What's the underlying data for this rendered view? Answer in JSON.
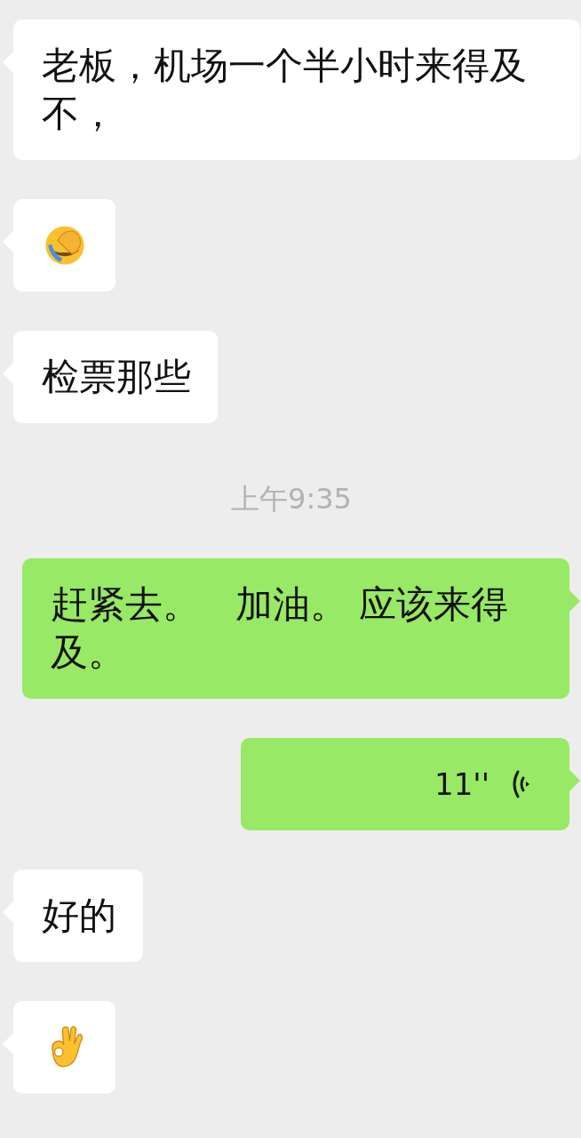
{
  "messages": [
    {
      "kind": "text",
      "outgoing": false,
      "text": "老板，机场一个半小时来得及不，"
    },
    {
      "kind": "facepalm",
      "outgoing": false
    },
    {
      "kind": "text",
      "outgoing": false,
      "text": "检票那些"
    },
    {
      "kind": "time",
      "text": "上午9:35"
    },
    {
      "kind": "text",
      "outgoing": true,
      "text": "赶紧去。   加油。 应该来得及。"
    },
    {
      "kind": "voice",
      "outgoing": true,
      "duration": "11''"
    },
    {
      "kind": "text",
      "outgoing": false,
      "text": "好的"
    },
    {
      "kind": "ok_hand",
      "outgoing": false
    }
  ]
}
